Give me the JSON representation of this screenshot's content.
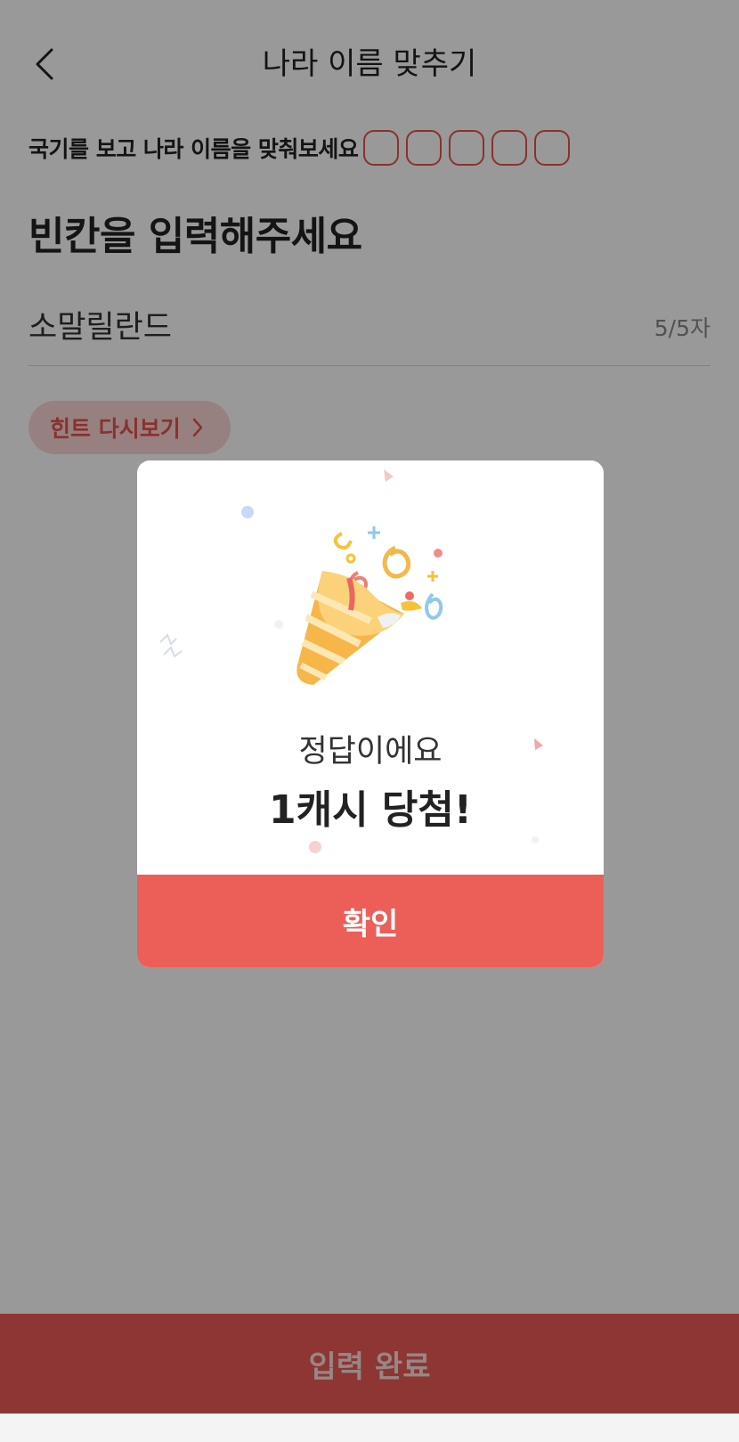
{
  "header": {
    "title": "나라 이름 맞추기",
    "back_icon": "chevron-left-icon"
  },
  "quiz": {
    "instruction": "국기를 보고 나라 이름을 맞춰보세요",
    "slot_count": 5,
    "prompt_heading": "빈칸을 입력해주세요",
    "answer_value": "소말릴란드",
    "char_count": "5/5자",
    "hint_label": "힌트 다시보기",
    "hint_icon": "chevron-right-icon"
  },
  "footer": {
    "submit_label": "입력 완료"
  },
  "modal": {
    "illustration": "party-popper-icon",
    "subtitle": "정답이에요",
    "title": "1캐시 당첨!",
    "confirm_label": "확인"
  },
  "colors": {
    "accent": "#ec5f59",
    "overlay": "rgba(0,0,0,0.40)"
  }
}
